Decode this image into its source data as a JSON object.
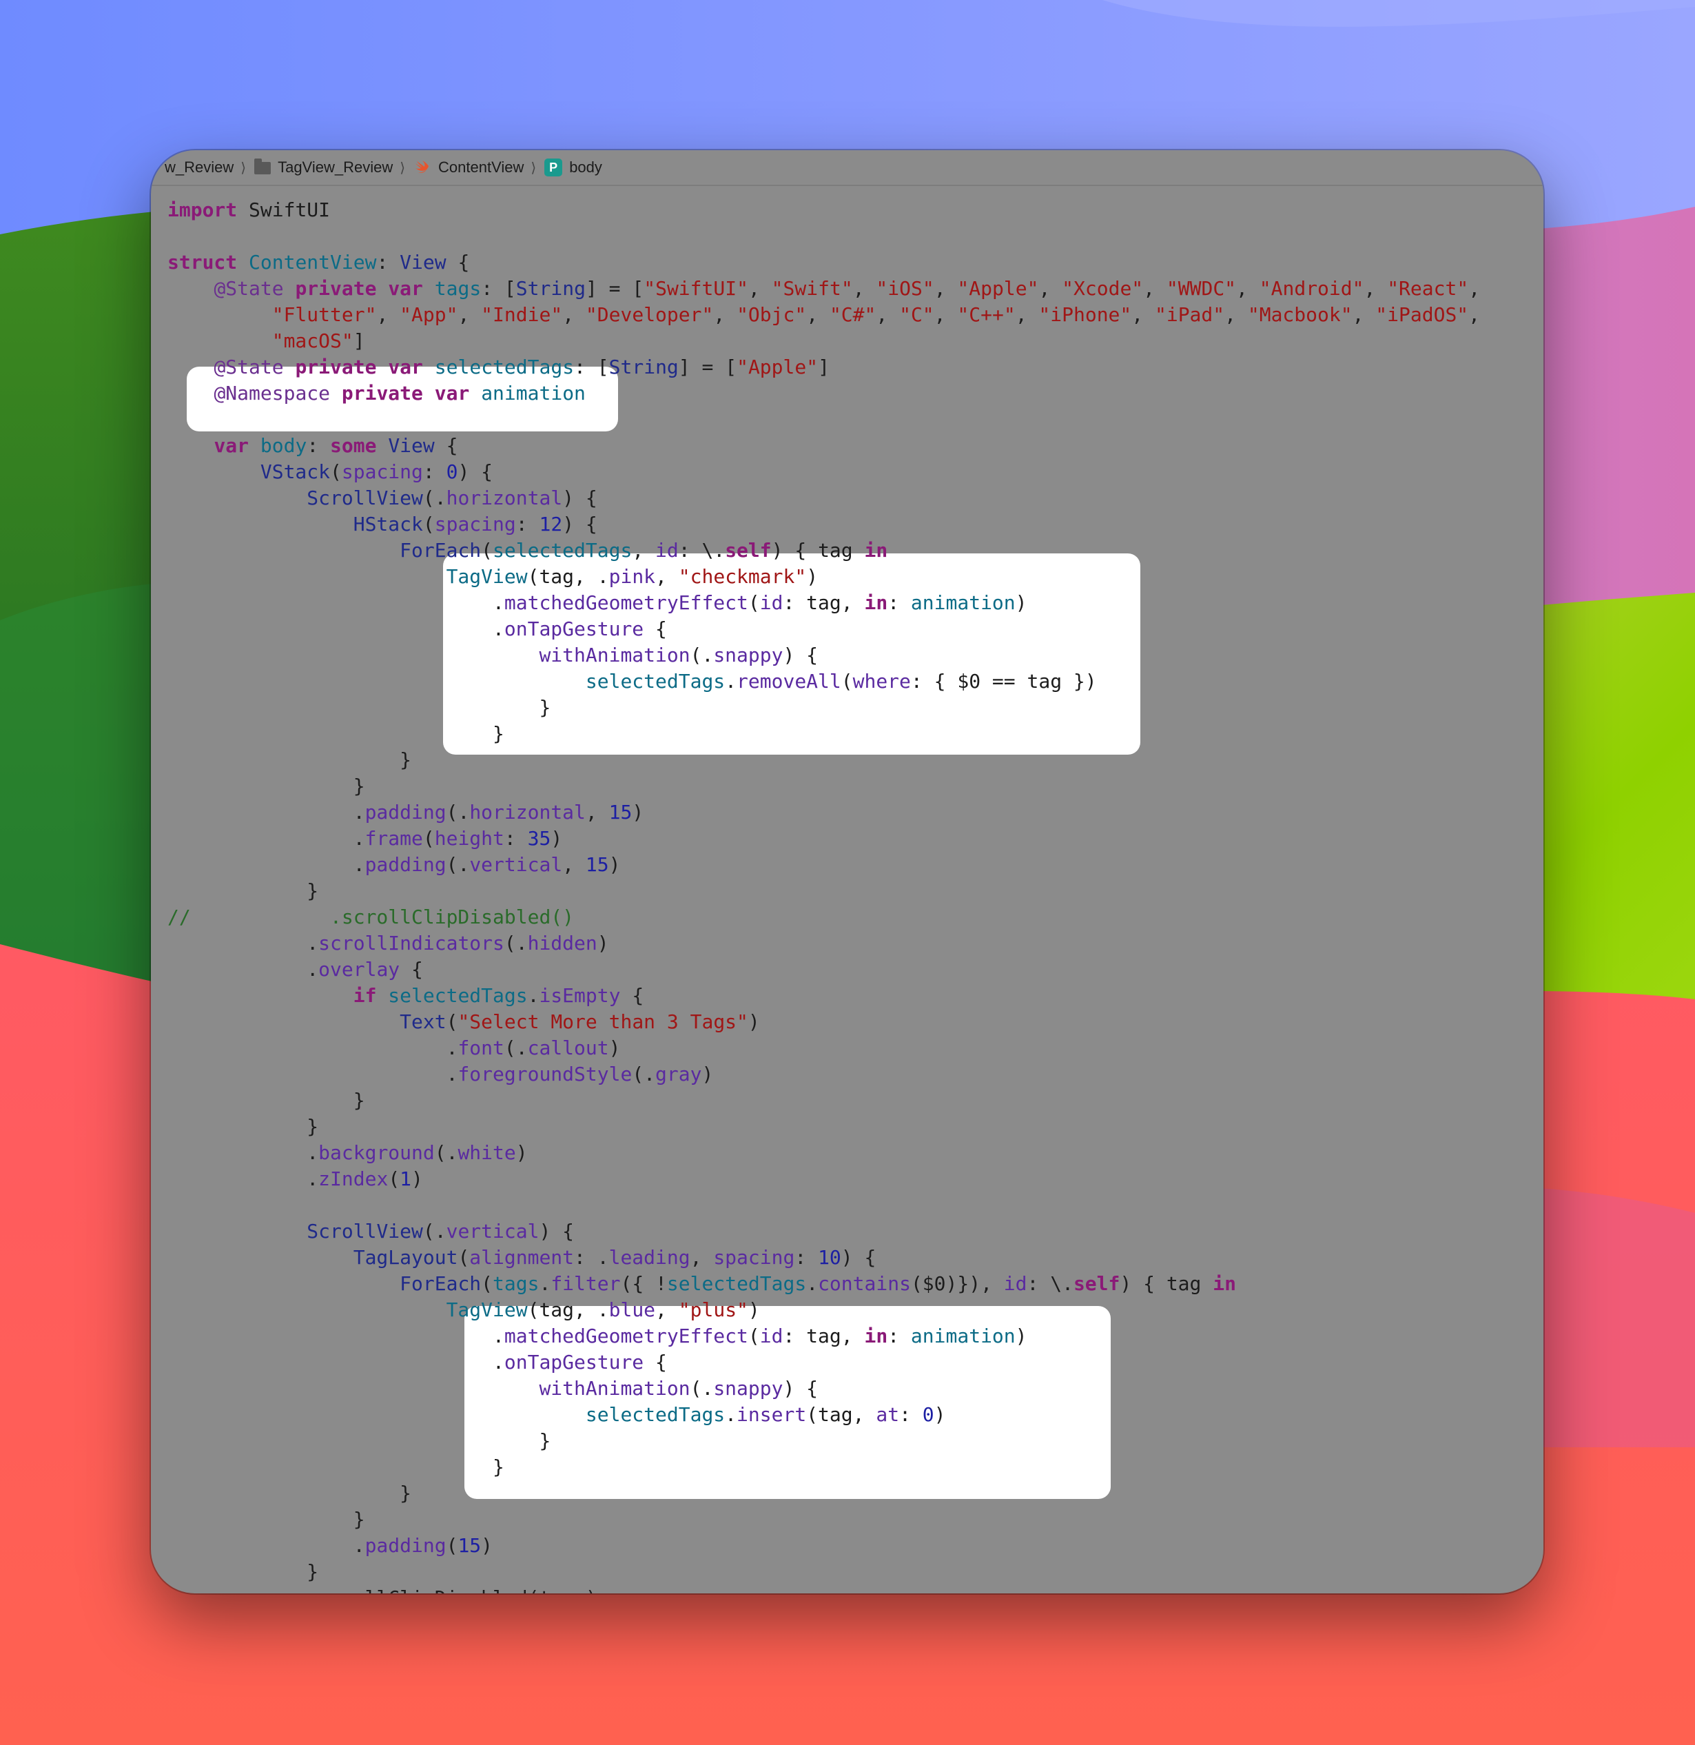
{
  "breadcrumb": {
    "items": [
      {
        "label": "w_Review",
        "icon": "folder-icon"
      },
      {
        "label": "TagView_Review",
        "icon": "folder-icon"
      },
      {
        "label": "ContentView",
        "icon": "swift-file-icon"
      },
      {
        "label": "body",
        "icon": "property-icon",
        "badge": "P"
      }
    ]
  },
  "code": {
    "highlighted_ranges": [
      "@Namespace declaration",
      "selected TagView block",
      "available TagView block"
    ],
    "lines": [
      [
        [
          "kw",
          "import"
        ],
        [
          "pl",
          " SwiftUI"
        ]
      ],
      [],
      [
        [
          "kw",
          "struct"
        ],
        [
          "pl",
          " "
        ],
        [
          "prop",
          "ContentView"
        ],
        [
          "pl",
          ": "
        ],
        [
          "typ",
          "View"
        ],
        [
          "pl",
          " {"
        ]
      ],
      [
        [
          "pl",
          "    "
        ],
        [
          "at",
          "@State"
        ],
        [
          "pl",
          " "
        ],
        [
          "kw",
          "private"
        ],
        [
          "pl",
          " "
        ],
        [
          "kw",
          "var"
        ],
        [
          "pl",
          " "
        ],
        [
          "prop",
          "tags"
        ],
        [
          "pl",
          ": ["
        ],
        [
          "typ",
          "String"
        ],
        [
          "pl",
          "] = ["
        ],
        [
          "str",
          "\"SwiftUI\""
        ],
        [
          "pl",
          ", "
        ],
        [
          "str",
          "\"Swift\""
        ],
        [
          "pl",
          ", "
        ],
        [
          "str",
          "\"iOS\""
        ],
        [
          "pl",
          ", "
        ],
        [
          "str",
          "\"Apple\""
        ],
        [
          "pl",
          ", "
        ],
        [
          "str",
          "\"Xcode\""
        ],
        [
          "pl",
          ", "
        ],
        [
          "str",
          "\"WWDC\""
        ],
        [
          "pl",
          ", "
        ],
        [
          "str",
          "\"Android\""
        ],
        [
          "pl",
          ", "
        ],
        [
          "str",
          "\"React\""
        ],
        [
          "pl",
          ","
        ]
      ],
      [
        [
          "pl",
          "         "
        ],
        [
          "str",
          "\"Flutter\""
        ],
        [
          "pl",
          ", "
        ],
        [
          "str",
          "\"App\""
        ],
        [
          "pl",
          ", "
        ],
        [
          "str",
          "\"Indie\""
        ],
        [
          "pl",
          ", "
        ],
        [
          "str",
          "\"Developer\""
        ],
        [
          "pl",
          ", "
        ],
        [
          "str",
          "\"Objc\""
        ],
        [
          "pl",
          ", "
        ],
        [
          "str",
          "\"C#\""
        ],
        [
          "pl",
          ", "
        ],
        [
          "str",
          "\"C\""
        ],
        [
          "pl",
          ", "
        ],
        [
          "str",
          "\"C++\""
        ],
        [
          "pl",
          ", "
        ],
        [
          "str",
          "\"iPhone\""
        ],
        [
          "pl",
          ", "
        ],
        [
          "str",
          "\"iPad\""
        ],
        [
          "pl",
          ", "
        ],
        [
          "str",
          "\"Macbook\""
        ],
        [
          "pl",
          ", "
        ],
        [
          "str",
          "\"iPadOS\""
        ],
        [
          "pl",
          ","
        ]
      ],
      [
        [
          "pl",
          "         "
        ],
        [
          "str",
          "\"macOS\""
        ],
        [
          "pl",
          "]"
        ]
      ],
      [
        [
          "pl",
          "    "
        ],
        [
          "at",
          "@State"
        ],
        [
          "pl",
          " "
        ],
        [
          "kw",
          "private"
        ],
        [
          "pl",
          " "
        ],
        [
          "kw",
          "var"
        ],
        [
          "pl",
          " "
        ],
        [
          "prop",
          "selectedTags"
        ],
        [
          "pl",
          ": ["
        ],
        [
          "typ",
          "String"
        ],
        [
          "pl",
          "] = ["
        ],
        [
          "str",
          "\"Apple\""
        ],
        [
          "pl",
          "]"
        ]
      ],
      [
        [
          "pl",
          "    "
        ],
        [
          "at",
          "@Namespace"
        ],
        [
          "pl",
          " "
        ],
        [
          "kw",
          "private"
        ],
        [
          "pl",
          " "
        ],
        [
          "kw",
          "var"
        ],
        [
          "pl",
          " "
        ],
        [
          "prop",
          "animation"
        ]
      ],
      [],
      [
        [
          "pl",
          "    "
        ],
        [
          "kw",
          "var"
        ],
        [
          "pl",
          " "
        ],
        [
          "prop",
          "body"
        ],
        [
          "pl",
          ": "
        ],
        [
          "kw",
          "some"
        ],
        [
          "pl",
          " "
        ],
        [
          "typ",
          "View"
        ],
        [
          "pl",
          " {"
        ]
      ],
      [
        [
          "pl",
          "        "
        ],
        [
          "typ",
          "VStack"
        ],
        [
          "pl",
          "("
        ],
        [
          "fn",
          "spacing"
        ],
        [
          "pl",
          ": "
        ],
        [
          "num",
          "0"
        ],
        [
          "pl",
          ") {"
        ]
      ],
      [
        [
          "pl",
          "            "
        ],
        [
          "typ",
          "ScrollView"
        ],
        [
          "pl",
          "(."
        ],
        [
          "fn",
          "horizontal"
        ],
        [
          "pl",
          ") {"
        ]
      ],
      [
        [
          "pl",
          "                "
        ],
        [
          "typ",
          "HStack"
        ],
        [
          "pl",
          "("
        ],
        [
          "fn",
          "spacing"
        ],
        [
          "pl",
          ": "
        ],
        [
          "num",
          "12"
        ],
        [
          "pl",
          ") {"
        ]
      ],
      [
        [
          "pl",
          "                    "
        ],
        [
          "typ",
          "ForEach"
        ],
        [
          "pl",
          "("
        ],
        [
          "prop",
          "selectedTags"
        ],
        [
          "pl",
          ", "
        ],
        [
          "fn",
          "id"
        ],
        [
          "pl",
          ": \\."
        ],
        [
          "kw",
          "self"
        ],
        [
          "pl",
          ") { tag "
        ],
        [
          "kw",
          "in"
        ]
      ],
      [
        [
          "pl",
          "                        "
        ],
        [
          "prop",
          "TagView"
        ],
        [
          "pl",
          "(tag, ."
        ],
        [
          "fn",
          "pink"
        ],
        [
          "pl",
          ", "
        ],
        [
          "str",
          "\"checkmark\""
        ],
        [
          "pl",
          ")"
        ]
      ],
      [
        [
          "pl",
          "                            ."
        ],
        [
          "fn",
          "matchedGeometryEffect"
        ],
        [
          "pl",
          "("
        ],
        [
          "fn",
          "id"
        ],
        [
          "pl",
          ": tag, "
        ],
        [
          "kw",
          "in"
        ],
        [
          "pl",
          ": "
        ],
        [
          "prop",
          "animation"
        ],
        [
          "pl",
          ")"
        ]
      ],
      [
        [
          "pl",
          "                            ."
        ],
        [
          "fn",
          "onTapGesture"
        ],
        [
          "pl",
          " {"
        ]
      ],
      [
        [
          "pl",
          "                                "
        ],
        [
          "fn",
          "withAnimation"
        ],
        [
          "pl",
          "(."
        ],
        [
          "fn",
          "snappy"
        ],
        [
          "pl",
          ") {"
        ]
      ],
      [
        [
          "pl",
          "                                    "
        ],
        [
          "prop",
          "selectedTags"
        ],
        [
          "pl",
          "."
        ],
        [
          "fn",
          "removeAll"
        ],
        [
          "pl",
          "("
        ],
        [
          "fn",
          "where"
        ],
        [
          "pl",
          ": { $0 == tag })"
        ]
      ],
      [
        [
          "pl",
          "                                }"
        ]
      ],
      [
        [
          "pl",
          "                            }"
        ]
      ],
      [
        [
          "pl",
          "                    }"
        ]
      ],
      [
        [
          "pl",
          "                }"
        ]
      ],
      [
        [
          "pl",
          "                ."
        ],
        [
          "fn",
          "padding"
        ],
        [
          "pl",
          "(."
        ],
        [
          "fn",
          "horizontal"
        ],
        [
          "pl",
          ", "
        ],
        [
          "num",
          "15"
        ],
        [
          "pl",
          ")"
        ]
      ],
      [
        [
          "pl",
          "                ."
        ],
        [
          "fn",
          "frame"
        ],
        [
          "pl",
          "("
        ],
        [
          "fn",
          "height"
        ],
        [
          "pl",
          ": "
        ],
        [
          "num",
          "35"
        ],
        [
          "pl",
          ")"
        ]
      ],
      [
        [
          "pl",
          "                ."
        ],
        [
          "fn",
          "padding"
        ],
        [
          "pl",
          "(."
        ],
        [
          "fn",
          "vertical"
        ],
        [
          "pl",
          ", "
        ],
        [
          "num",
          "15"
        ],
        [
          "pl",
          ")"
        ]
      ],
      [
        [
          "pl",
          "            }"
        ]
      ],
      [
        [
          "cm",
          "//            .scrollClipDisabled()"
        ]
      ],
      [
        [
          "pl",
          "            ."
        ],
        [
          "fn",
          "scrollIndicators"
        ],
        [
          "pl",
          "(."
        ],
        [
          "fn",
          "hidden"
        ],
        [
          "pl",
          ")"
        ]
      ],
      [
        [
          "pl",
          "            ."
        ],
        [
          "fn",
          "overlay"
        ],
        [
          "pl",
          " {"
        ]
      ],
      [
        [
          "pl",
          "                "
        ],
        [
          "kw",
          "if"
        ],
        [
          "pl",
          " "
        ],
        [
          "prop",
          "selectedTags"
        ],
        [
          "pl",
          "."
        ],
        [
          "fn",
          "isEmpty"
        ],
        [
          "pl",
          " {"
        ]
      ],
      [
        [
          "pl",
          "                    "
        ],
        [
          "typ",
          "Text"
        ],
        [
          "pl",
          "("
        ],
        [
          "str",
          "\"Select More than 3 Tags\""
        ],
        [
          "pl",
          ")"
        ]
      ],
      [
        [
          "pl",
          "                        ."
        ],
        [
          "fn",
          "font"
        ],
        [
          "pl",
          "(."
        ],
        [
          "fn",
          "callout"
        ],
        [
          "pl",
          ")"
        ]
      ],
      [
        [
          "pl",
          "                        ."
        ],
        [
          "fn",
          "foregroundStyle"
        ],
        [
          "pl",
          "(."
        ],
        [
          "fn",
          "gray"
        ],
        [
          "pl",
          ")"
        ]
      ],
      [
        [
          "pl",
          "                }"
        ]
      ],
      [
        [
          "pl",
          "            }"
        ]
      ],
      [
        [
          "pl",
          "            ."
        ],
        [
          "fn",
          "background"
        ],
        [
          "pl",
          "(."
        ],
        [
          "fn",
          "white"
        ],
        [
          "pl",
          ")"
        ]
      ],
      [
        [
          "pl",
          "            ."
        ],
        [
          "fn",
          "zIndex"
        ],
        [
          "pl",
          "("
        ],
        [
          "num",
          "1"
        ],
        [
          "pl",
          ")"
        ]
      ],
      [],
      [
        [
          "pl",
          "            "
        ],
        [
          "typ",
          "ScrollView"
        ],
        [
          "pl",
          "(."
        ],
        [
          "fn",
          "vertical"
        ],
        [
          "pl",
          ") {"
        ]
      ],
      [
        [
          "pl",
          "                "
        ],
        [
          "typ",
          "TagLayout"
        ],
        [
          "pl",
          "("
        ],
        [
          "fn",
          "alignment"
        ],
        [
          "pl",
          ": ."
        ],
        [
          "fn",
          "leading"
        ],
        [
          "pl",
          ", "
        ],
        [
          "fn",
          "spacing"
        ],
        [
          "pl",
          ": "
        ],
        [
          "num",
          "10"
        ],
        [
          "pl",
          ") {"
        ]
      ],
      [
        [
          "pl",
          "                    "
        ],
        [
          "typ",
          "ForEach"
        ],
        [
          "pl",
          "("
        ],
        [
          "prop",
          "tags"
        ],
        [
          "pl",
          "."
        ],
        [
          "fn",
          "filter"
        ],
        [
          "pl",
          "({ !"
        ],
        [
          "prop",
          "selectedTags"
        ],
        [
          "pl",
          "."
        ],
        [
          "fn",
          "contains"
        ],
        [
          "pl",
          "($0)}), "
        ],
        [
          "fn",
          "id"
        ],
        [
          "pl",
          ": \\."
        ],
        [
          "kw",
          "self"
        ],
        [
          "pl",
          ") { tag "
        ],
        [
          "kw",
          "in"
        ]
      ],
      [
        [
          "pl",
          "                        "
        ],
        [
          "prop",
          "TagView"
        ],
        [
          "pl",
          "(tag, ."
        ],
        [
          "fn",
          "blue"
        ],
        [
          "pl",
          ", "
        ],
        [
          "str",
          "\"plus\""
        ],
        [
          "pl",
          ")"
        ]
      ],
      [
        [
          "pl",
          "                            ."
        ],
        [
          "fn",
          "matchedGeometryEffect"
        ],
        [
          "pl",
          "("
        ],
        [
          "fn",
          "id"
        ],
        [
          "pl",
          ": tag, "
        ],
        [
          "kw",
          "in"
        ],
        [
          "pl",
          ": "
        ],
        [
          "prop",
          "animation"
        ],
        [
          "pl",
          ")"
        ]
      ],
      [
        [
          "pl",
          "                            ."
        ],
        [
          "fn",
          "onTapGesture"
        ],
        [
          "pl",
          " {"
        ]
      ],
      [
        [
          "pl",
          "                                "
        ],
        [
          "fn",
          "withAnimation"
        ],
        [
          "pl",
          "(."
        ],
        [
          "fn",
          "snappy"
        ],
        [
          "pl",
          ") {"
        ]
      ],
      [
        [
          "pl",
          "                                    "
        ],
        [
          "prop",
          "selectedTags"
        ],
        [
          "pl",
          "."
        ],
        [
          "fn",
          "insert"
        ],
        [
          "pl",
          "(tag, "
        ],
        [
          "fn",
          "at"
        ],
        [
          "pl",
          ": "
        ],
        [
          "num",
          "0"
        ],
        [
          "pl",
          ")"
        ]
      ],
      [
        [
          "pl",
          "                                }"
        ]
      ],
      [
        [
          "pl",
          "                            }"
        ]
      ],
      [
        [
          "pl",
          "                    }"
        ]
      ],
      [
        [
          "pl",
          "                }"
        ]
      ],
      [
        [
          "pl",
          "                ."
        ],
        [
          "fn",
          "padding"
        ],
        [
          "pl",
          "("
        ],
        [
          "num",
          "15"
        ],
        [
          "pl",
          ")"
        ]
      ],
      [
        [
          "pl",
          "            }"
        ]
      ],
      [
        [
          "pl",
          "            .scrollClipDisabled(true)"
        ]
      ]
    ]
  }
}
